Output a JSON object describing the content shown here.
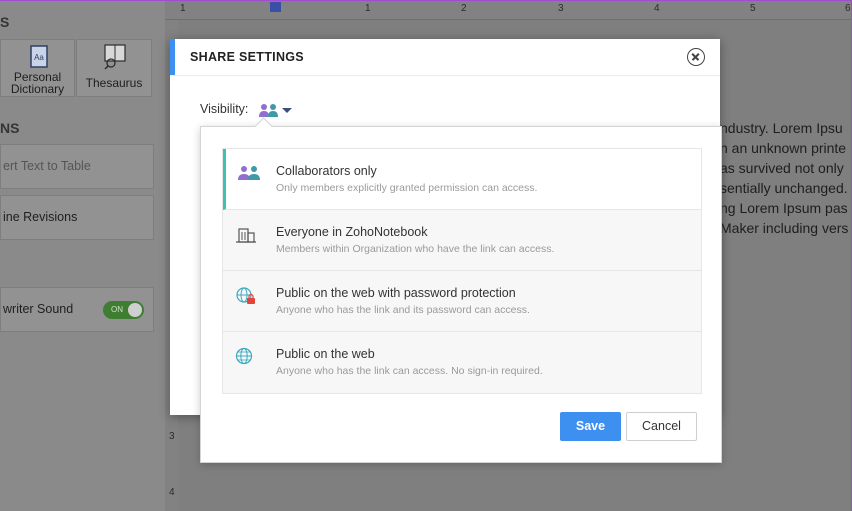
{
  "sidebar": {
    "top_letter": "S",
    "tiles": [
      {
        "label_line1": "Personal",
        "label_line2": "Dictionary",
        "icon": "dictionary-icon"
      },
      {
        "label": "Thesaurus",
        "icon": "thesaurus-icon"
      }
    ],
    "section_heading": "NS",
    "rows": [
      {
        "label": "ert Text to Table"
      },
      {
        "label": "ine Revisions"
      },
      {
        "label": "writer Sound"
      }
    ],
    "toggle_label": "ON"
  },
  "ruler": {
    "numbers": [
      "1",
      "1",
      "1",
      "2",
      "3",
      "4",
      "5",
      "6"
    ],
    "left_numbers": [
      "3",
      "4"
    ]
  },
  "document": {
    "lines": [
      "ndustry. Lorem Ipsu",
      "n an unknown printe",
      "as survived not only",
      "sentially unchanged.",
      "ng Lorem Ipsum pas",
      "Maker including vers"
    ]
  },
  "modal": {
    "title": "SHARE SETTINGS",
    "visibility_label": "Visibility:",
    "visibility_icon": "collaborators-icon",
    "options": [
      {
        "title": "Collaborators only",
        "description": "Only members explicitly granted permission can access.",
        "icon": "collaborators-icon",
        "selected": true
      },
      {
        "title": "Everyone in ZohoNotebook",
        "description": "Members within Organization who have the link can access.",
        "icon": "building-icon",
        "selected": false
      },
      {
        "title": "Public on the web with password protection",
        "description": "Anyone who has the link and its password can access.",
        "icon": "globe-lock-icon",
        "selected": false
      },
      {
        "title": "Public on the web",
        "description": "Anyone who has the link can access. No sign-in required.",
        "icon": "globe-icon",
        "selected": false
      }
    ],
    "save_label": "Save",
    "cancel_label": "Cancel"
  },
  "colors": {
    "accent": "#3d8ff0",
    "selected_bar": "#3fc0b3",
    "toggle_on": "#3f7d33"
  }
}
